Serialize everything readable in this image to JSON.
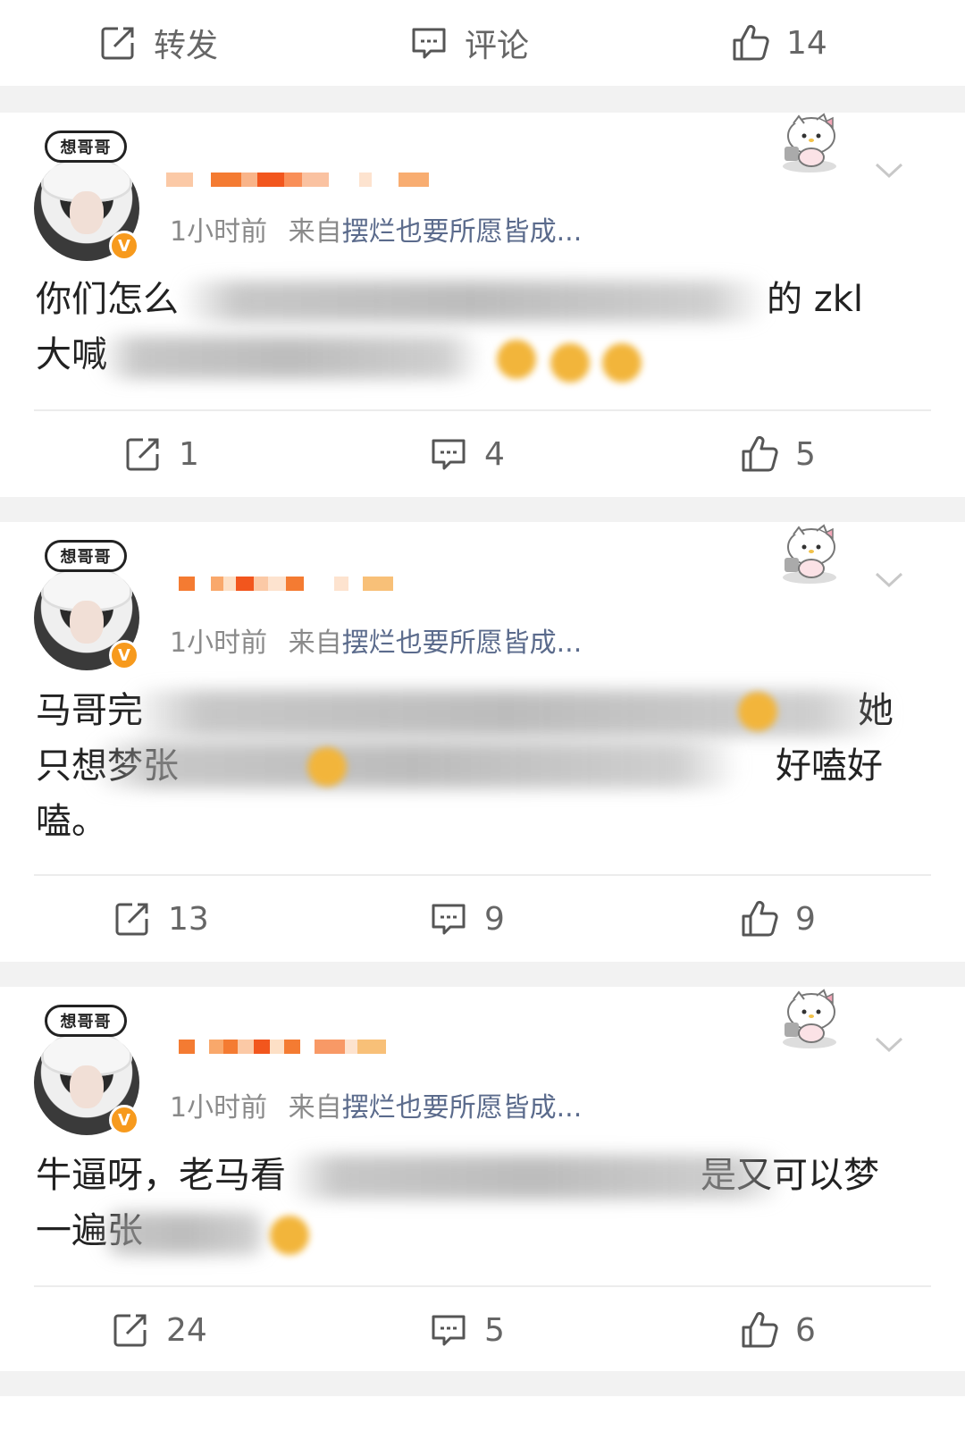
{
  "top_bar": {
    "repost_label": "转发",
    "comment_label": "评论",
    "like_count": "14"
  },
  "posts": [
    {
      "avatar_badge_text": "想哥哥",
      "verified_badge": "V",
      "time": "1小时前",
      "from_label": "来自",
      "source": "摆烂也要所愿皆成...",
      "line1_start": "你们怎么",
      "line1_end": "的 zkl",
      "line2_start": "大喊",
      "repost_count": "1",
      "comment_count": "4",
      "like_count": "5"
    },
    {
      "avatar_badge_text": "想哥哥",
      "verified_badge": "V",
      "time": "1小时前",
      "from_label": "来自",
      "source": "摆烂也要所愿皆成...",
      "line1_start": "马哥完",
      "line1_end": "她",
      "line2_start": "只想梦张",
      "line2_end": "好嗑好",
      "line3": "嗑。",
      "repost_count": "13",
      "comment_count": "9",
      "like_count": "9"
    },
    {
      "avatar_badge_text": "想哥哥",
      "verified_badge": "V",
      "time": "1小时前",
      "from_label": "来自",
      "source": "摆烂也要所愿皆成...",
      "line1_start": "牛逼呀，老马看",
      "line1_end": "是又可以梦",
      "line2_start": "一遍张",
      "repost_count": "24",
      "comment_count": "5",
      "like_count": "6"
    }
  ],
  "colors": {
    "accent_orange": "#f79a1d",
    "source_blue": "#5b6b8c",
    "meta_gray": "#8a8a8a"
  },
  "icons": {
    "repost": "share-box-icon",
    "comment": "comment-bubble-icon",
    "like": "thumbs-up-icon",
    "expand": "chevron-down-icon"
  }
}
